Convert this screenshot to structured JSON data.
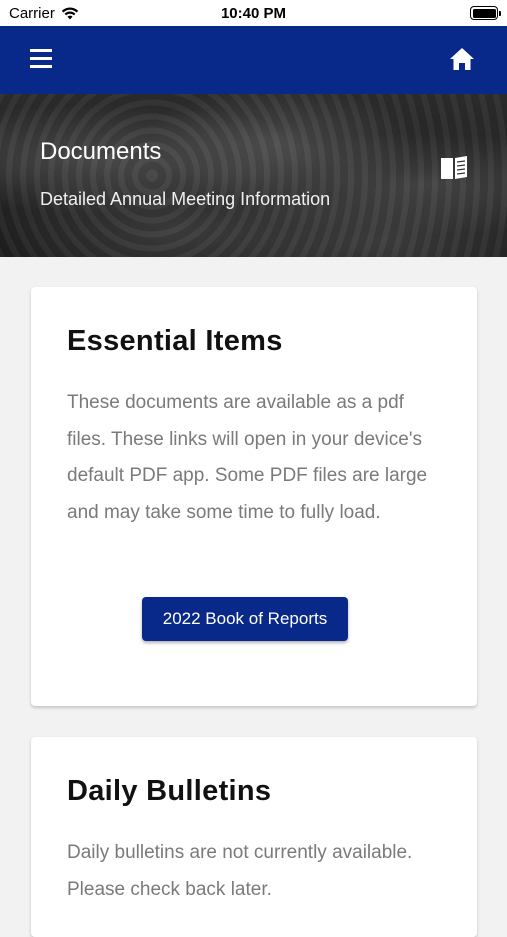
{
  "status_bar": {
    "carrier": "Carrier",
    "time": "10:40 PM"
  },
  "header": {
    "menu_icon": "hamburger-menu-icon",
    "home_icon": "home-icon",
    "color": "#08298a"
  },
  "hero": {
    "title": "Documents",
    "subtitle": "Detailed Annual Meeting Information",
    "icon": "book-icon"
  },
  "cards": [
    {
      "title": "Essential Items",
      "body": "These documents are available as a pdf files. These links will open in your device's default PDF app. Some PDF files are large and may take some time to fully load.",
      "button_label": "2022 Book of Reports"
    },
    {
      "title": "Daily Bulletins",
      "body": "Daily bulletins are not currently available. Please check back later."
    }
  ]
}
